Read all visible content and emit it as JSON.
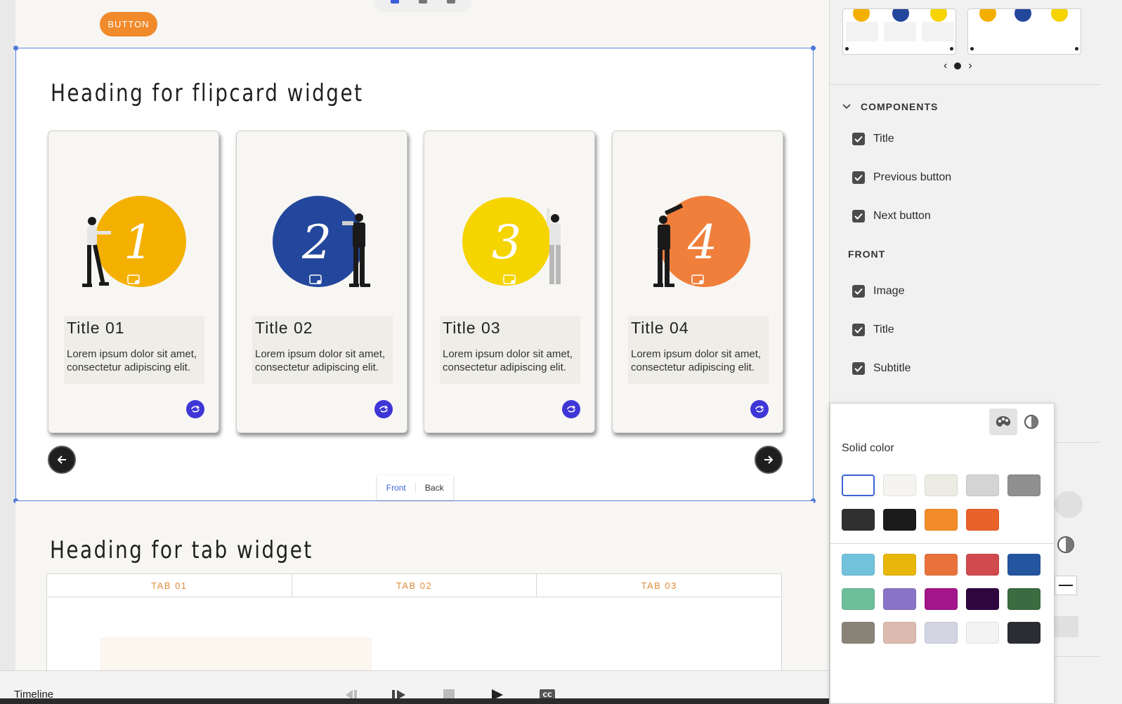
{
  "canvas": {
    "top_button_label": "BUTTON",
    "flip_heading": "Heading for flipcard widget",
    "cards": [
      {
        "title": "Title 01",
        "desc": "Lorem ipsum dolor sit amet, consectetur adipiscing elit.",
        "number": "1",
        "circle_color": "#f4b000"
      },
      {
        "title": "Title 02",
        "desc": "Lorem ipsum dolor sit amet, consectetur adipiscing elit.",
        "number": "2",
        "circle_color": "#23479c"
      },
      {
        "title": "Title 03",
        "desc": "Lorem ipsum dolor sit amet, consectetur adipiscing elit.",
        "number": "3",
        "circle_color": "#f5d400"
      },
      {
        "title": "Title 04",
        "desc": "Lorem ipsum dolor sit amet, consectetur adipiscing elit.",
        "number": "4",
        "circle_color": "#f07f3c"
      }
    ],
    "toggle": {
      "front": "Front",
      "back": "Back"
    },
    "tab_heading": "Heading for tab widget",
    "tabs": [
      "TAB 01",
      "TAB 02",
      "TAB 03"
    ]
  },
  "timeline": {
    "label": "Timeline"
  },
  "panel": {
    "components_header": "COMPONENTS",
    "components": [
      "Title",
      "Previous button",
      "Next button"
    ],
    "front_header": "FRONT",
    "front_items": [
      "Image",
      "Title",
      "Subtitle"
    ]
  },
  "color_picker": {
    "title": "Solid color",
    "row1": [
      "#ffffff",
      "#f5f4f0",
      "#ecebe4",
      "#d4d4d4",
      "#8f8f8f"
    ],
    "row2": [
      "#303030",
      "#1b1b1b",
      "#f28c28",
      "#e8622a"
    ],
    "row3": [
      "#72c2dc",
      "#e8b70a",
      "#e8723a",
      "#d04a4e",
      "#24559f"
    ],
    "row4": [
      "#6dbf99",
      "#8a74c8",
      "#a3158a",
      "#30063f",
      "#3b6b40"
    ],
    "row5": [
      "#8a8378",
      "#dcbab0",
      "#d3d6e2",
      "#f3f3f3",
      "#2a2d32"
    ]
  },
  "colors": {
    "accent": "#3a63d4",
    "flip_button": "#3e36d6",
    "tab_text": "#e08a3c",
    "orange_button": "#f08a2a"
  }
}
